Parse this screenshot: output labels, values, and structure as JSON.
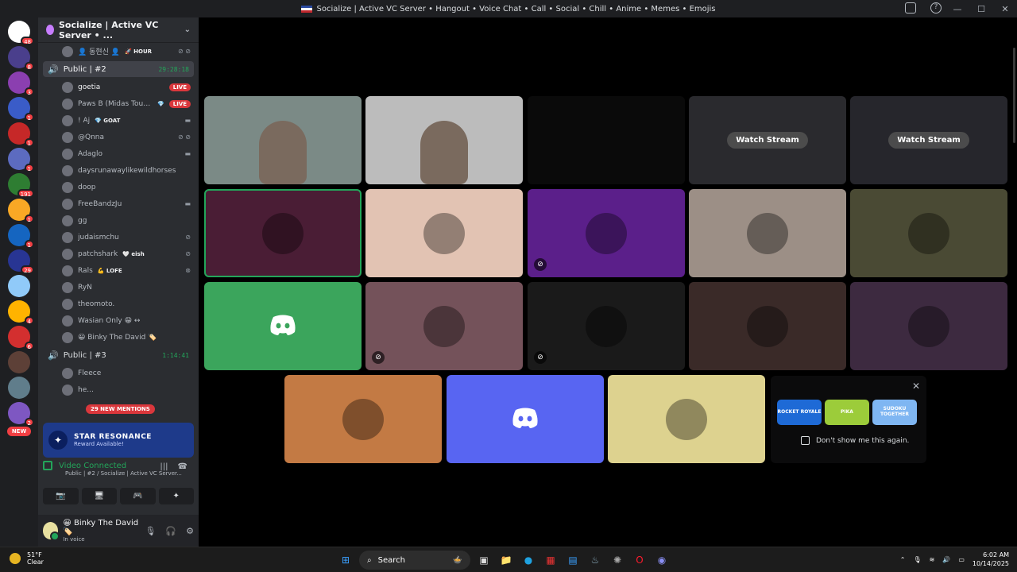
{
  "window": {
    "title": "Socialize | Active VC Server • Hangout • Voice Chat • Call • Social • Chill • Anime • Memes • Emojis",
    "controls": [
      "—",
      "☐",
      "✕"
    ]
  },
  "rail": {
    "servers": [
      {
        "color": "#ffffff",
        "badge": "48"
      },
      {
        "color": "#4a3f8c",
        "badge": "8"
      },
      {
        "color": "#8b3fb0",
        "badge": "3"
      },
      {
        "color": "#3a5cc8",
        "badge": "1"
      },
      {
        "color": "#c62828",
        "badge": "1"
      },
      {
        "color": "#5c6bc0",
        "badge": "1"
      },
      {
        "color": "#2e7d32",
        "badge": "191"
      },
      {
        "color": "#f9a825",
        "badge": "1"
      },
      {
        "color": "#1565c0",
        "badge": "1"
      },
      {
        "color": "#283593",
        "badge": "29"
      },
      {
        "color": "#90caf9",
        "badge": ""
      },
      {
        "color": "#ffb300",
        "badge": "4"
      },
      {
        "color": "#d32f2f",
        "badge": "6"
      },
      {
        "color": "#5d4037",
        "badge": ""
      },
      {
        "color": "#607d8b",
        "badge": ""
      },
      {
        "color": "#7e57c2",
        "badge": "2"
      }
    ],
    "new_label": "NEW"
  },
  "sidebar": {
    "server_name": "Socialize | Active VC Server • ...",
    "top_user": {
      "name": "👤 동현신 👤",
      "tag": "🚀 HOUR"
    },
    "channel1": {
      "name": "Public | #2",
      "timer": "29:28:18"
    },
    "members1": [
      {
        "name": "goetia",
        "tag": "",
        "live": "LIVE",
        "icon": ""
      },
      {
        "name": "Paws B (Midas Touché)",
        "tag": "💎",
        "live": "LIVE",
        "icon": ""
      },
      {
        "name": "! Aj",
        "tag": "💎 GOAT",
        "live": "",
        "icon": "▬"
      },
      {
        "name": "@Qnna",
        "tag": "",
        "live": "",
        "icon": "⊘ ⊘"
      },
      {
        "name": "Adaglo",
        "tag": "",
        "live": "",
        "icon": "▬"
      },
      {
        "name": "daysrunawaylikewildhorses",
        "tag": "",
        "live": "",
        "icon": ""
      },
      {
        "name": "doop",
        "tag": "",
        "live": "",
        "icon": ""
      },
      {
        "name": "FreeBandzJu",
        "tag": "",
        "live": "",
        "icon": "▬"
      },
      {
        "name": "gg",
        "tag": "",
        "live": "",
        "icon": ""
      },
      {
        "name": "judaismchu",
        "tag": "",
        "live": "",
        "icon": "⊘"
      },
      {
        "name": "patchshark",
        "tag": "🤍 eish",
        "live": "",
        "icon": "⊘"
      },
      {
        "name": "Rals",
        "tag": "💪 LOFE",
        "live": "",
        "icon": "⊗"
      },
      {
        "name": "RyN",
        "tag": "",
        "live": "",
        "icon": ""
      },
      {
        "name": "theomoto.",
        "tag": "",
        "live": "",
        "icon": ""
      },
      {
        "name": "Wasian Only 😁 ↔",
        "tag": "",
        "live": "",
        "icon": ""
      },
      {
        "name": "😀 Binky The David 🏷️",
        "tag": "",
        "live": "",
        "icon": ""
      }
    ],
    "channel2": {
      "name": "Public | #3",
      "timer": "1:14:41"
    },
    "members2": [
      {
        "name": "Fleece"
      },
      {
        "name": "he..."
      }
    ],
    "mentions": "29 NEW MENTIONS"
  },
  "promo": {
    "title": "STAR RESONANCE",
    "subtitle": "Reward Available!"
  },
  "voice": {
    "status": "Video Connected",
    "location": "Public | #2 / Socialize | Active VC Server...",
    "buttons": [
      "📷",
      "🖥",
      "🎮",
      "✦"
    ]
  },
  "user": {
    "name": "😀 Binky The David 🏷️",
    "status": "In voice"
  },
  "stage": {
    "tiles": [
      {
        "kind": "video",
        "bg": "#7b8a86",
        "label": ""
      },
      {
        "kind": "video",
        "bg": "#bcbcbc",
        "label": ""
      },
      {
        "kind": "video",
        "bg": "#0a0a0a",
        "label": ""
      },
      {
        "kind": "stream",
        "bg": "#2a2a2e",
        "label": "Watch Stream"
      },
      {
        "kind": "stream",
        "bg": "#26262c",
        "label": "Watch Stream"
      },
      {
        "kind": "avatar",
        "bg": "#4a1d35",
        "label": ""
      },
      {
        "kind": "avatar",
        "bg": "#e2c3b3",
        "label": ""
      },
      {
        "kind": "avatar",
        "bg": "#5b1f8a",
        "label": ""
      },
      {
        "kind": "avatar",
        "bg": "#9c8f86",
        "label": ""
      },
      {
        "kind": "avatar",
        "bg": "#4a4a34",
        "label": ""
      },
      {
        "kind": "discord",
        "bg": "#3ba55c",
        "label": ""
      },
      {
        "kind": "avatar",
        "bg": "#74525a",
        "label": ""
      },
      {
        "kind": "avatar",
        "bg": "#1a1a1a",
        "label": ""
      },
      {
        "kind": "avatar",
        "bg": "#3a2a28",
        "label": ""
      },
      {
        "kind": "avatar",
        "bg": "#3d2a40",
        "label": ""
      },
      {
        "kind": "avatar",
        "bg": "#c37a44",
        "label": ""
      },
      {
        "kind": "discord",
        "bg": "#5865f2",
        "label": ""
      },
      {
        "kind": "avatar",
        "bg": "#ddd28f",
        "label": ""
      }
    ]
  },
  "activity": {
    "games": [
      {
        "name": "ROCKET ROYALE",
        "color": "#1e6ad6"
      },
      {
        "name": "PIKA",
        "color": "#9ccc3a"
      },
      {
        "name": "SUDOKU TOGETHER",
        "color": "#7fb6f2"
      }
    ],
    "dont_show": "Don't show me this again."
  },
  "taskbar": {
    "temp": "51°F",
    "condition": "Clear",
    "search": "Search",
    "time": "6:02 AM",
    "date": "10/14/2025"
  }
}
